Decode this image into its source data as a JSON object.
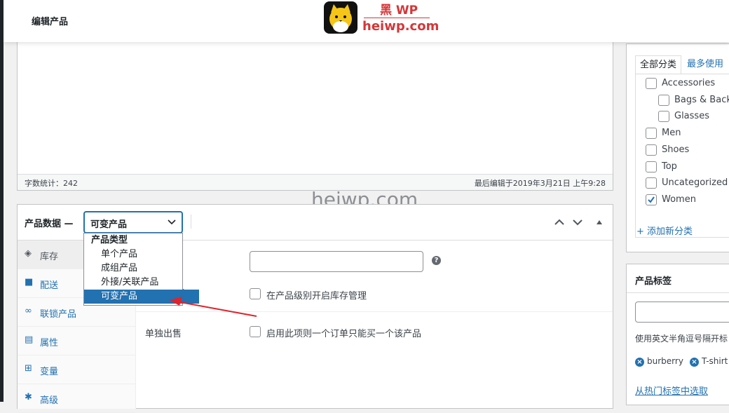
{
  "header": {
    "page_title": "编辑产品",
    "logo_cn": "黑 WP",
    "logo_domain": "heiwp.com"
  },
  "editor": {
    "word_count": "字数统计：242",
    "last_edited": "最后编辑于2019年3月21日 上午9:28"
  },
  "watermark": "heiwp.com",
  "product_data": {
    "title": "产品数据 —",
    "type_select_value": "可变产品",
    "dropdown": {
      "group_label": "产品类型",
      "options": [
        "单个产品",
        "成组产品",
        "外接/关联产品",
        "可变产品"
      ],
      "selected": "可变产品"
    },
    "tabs": [
      {
        "label": "库存",
        "icon": "tag-icon"
      },
      {
        "label": "配送",
        "icon": "truck-icon"
      },
      {
        "label": "联锁产品",
        "icon": "link-icon"
      },
      {
        "label": "属性",
        "icon": "list-icon"
      },
      {
        "label": "变量",
        "icon": "grid-icon"
      },
      {
        "label": "高级",
        "icon": "gear-icon"
      }
    ],
    "manage_stock_partial": "?",
    "manage_stock_label": "在产品级别开启库存管理",
    "sold_individually_label": "单独出售",
    "sold_individually_desc": "启用此项则一个订单只能买一个该产品"
  },
  "categories": {
    "tab_all": "全部分类",
    "tab_popular": "最多使用",
    "items": [
      {
        "label": "Accessories",
        "checked": false,
        "level": 0
      },
      {
        "label": "Bags & Backp",
        "checked": false,
        "level": 1
      },
      {
        "label": "Glasses",
        "checked": false,
        "level": 1
      },
      {
        "label": "Men",
        "checked": false,
        "level": 0
      },
      {
        "label": "Shoes",
        "checked": false,
        "level": 0
      },
      {
        "label": "Top",
        "checked": false,
        "level": 0
      },
      {
        "label": "Uncategorized",
        "checked": false,
        "level": 0
      },
      {
        "label": "Women",
        "checked": true,
        "level": 0
      }
    ],
    "add_new": "+ 添加新分类"
  },
  "tags": {
    "title": "产品标签",
    "hint": "使用英文半角逗号隔开标",
    "chips": [
      "burberry",
      "T-shirt"
    ],
    "popular_link": "从热门标签中选取"
  },
  "colors": {
    "accent": "#2271b1",
    "arrow": "#e0232b",
    "brand_red": "#d63638"
  }
}
